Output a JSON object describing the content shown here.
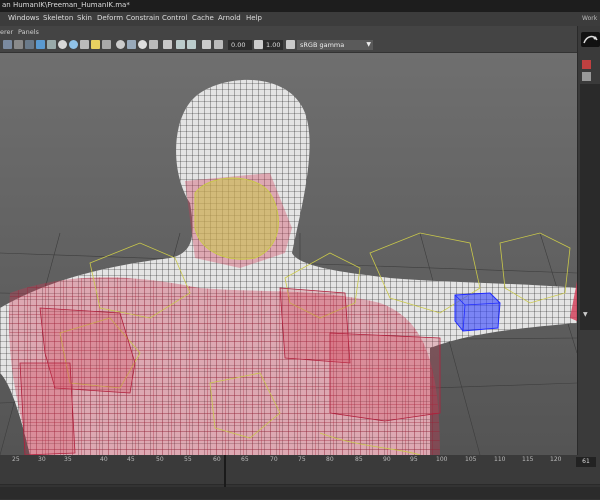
{
  "window": {
    "title": "an HumanIK\\Freeman_HumanIK.ma*"
  },
  "menubar": {
    "items": [
      "Windows",
      "Skeleton",
      "Skin",
      "Deform",
      "Constrain",
      "Control",
      "Cache",
      "Arnold",
      "Help"
    ],
    "workspace_label": "Work"
  },
  "panel_menu": {
    "items": [
      "erer",
      "Panels"
    ]
  },
  "toolbar": {
    "exposure_value": "0.00",
    "gamma_value": "1.00",
    "color_management": "sRGB gamma"
  },
  "timeline": {
    "tick_labels": [
      "25",
      "30",
      "35",
      "40",
      "45",
      "50",
      "55",
      "60",
      "65",
      "70",
      "75",
      "80",
      "85",
      "90",
      "95",
      "100",
      "105",
      "110",
      "115",
      "120"
    ],
    "current_frame": "61",
    "current_frame_field": "61"
  },
  "colors": {
    "skin_weight_red": "#d23a55",
    "selected_blue": "#3344ff",
    "control_yellow": "#c9c84a"
  }
}
